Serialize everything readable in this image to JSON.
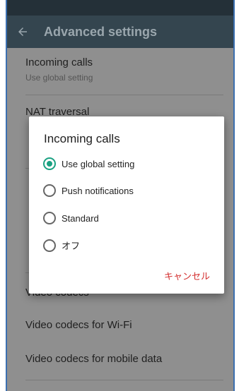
{
  "appbar": {
    "title": "Advanced settings",
    "back_icon": "arrow-left-icon"
  },
  "prefs": [
    {
      "title": "Incoming calls",
      "subtitle": "Use global setting"
    },
    {
      "title": "NAT traversal"
    },
    {
      "title": "Video codecs"
    },
    {
      "title": "Video codecs for Wi-Fi"
    },
    {
      "title": "Video codecs for mobile data"
    }
  ],
  "dialog": {
    "title": "Incoming calls",
    "options": [
      {
        "label": "Use global setting",
        "selected": true
      },
      {
        "label": "Push notifications",
        "selected": false
      },
      {
        "label": "Standard",
        "selected": false
      },
      {
        "label": "オフ",
        "selected": false
      }
    ],
    "cancel_label": "キャンセル"
  },
  "colors": {
    "accent": "#1aa182",
    "cancel": "#d32f2f",
    "appbar": "#34454f"
  }
}
